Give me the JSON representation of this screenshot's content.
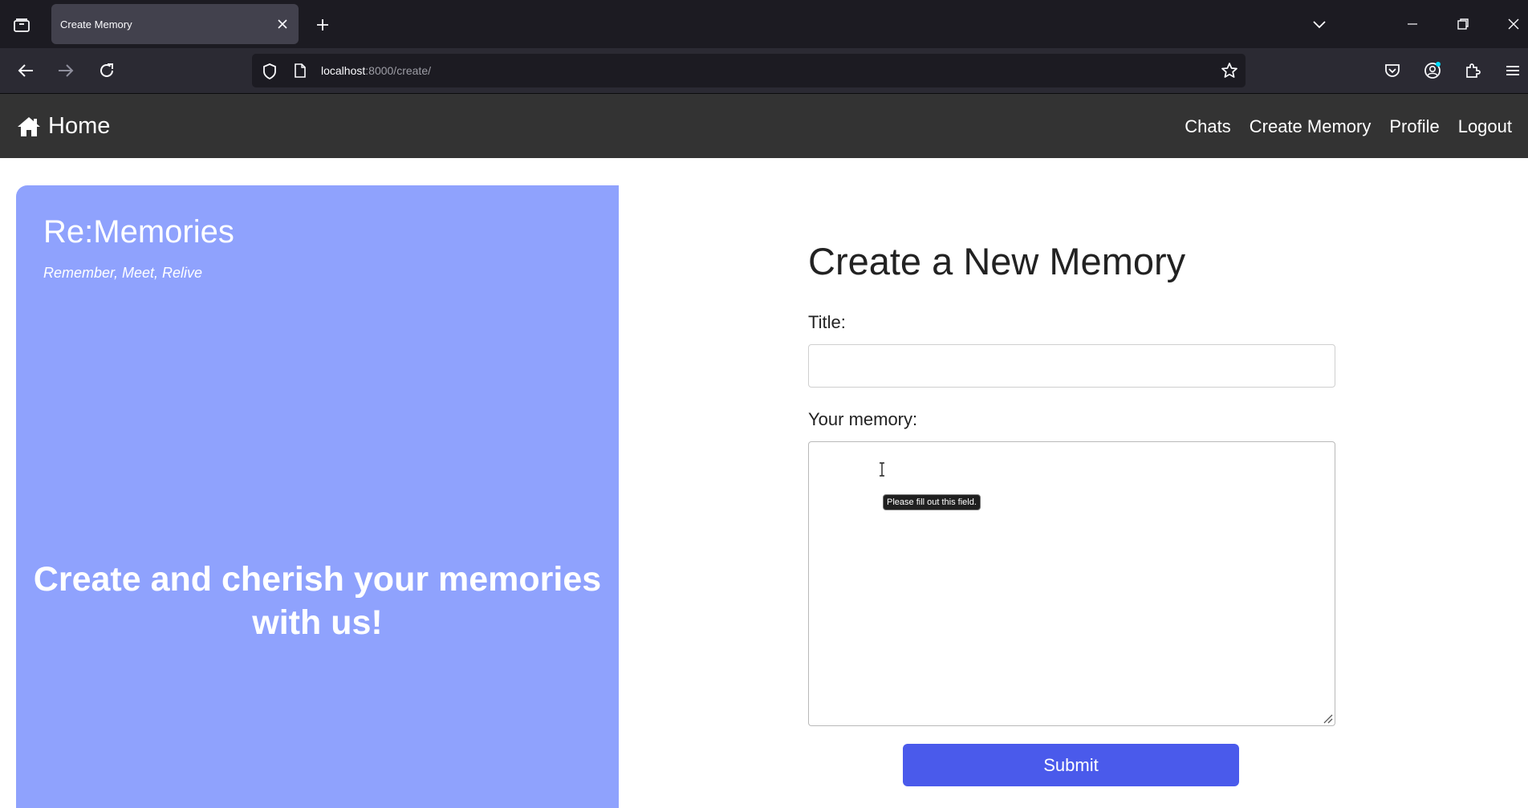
{
  "browser": {
    "tab_title": "Create Memory",
    "url_host": "localhost",
    "url_path": ":8000/create/"
  },
  "site": {
    "brand_label": "Home",
    "nav": [
      "Chats",
      "Create Memory",
      "Profile",
      "Logout"
    ]
  },
  "hero": {
    "title": "Re:Memories",
    "tagline": "Remember, Meet, Relive",
    "message": "Create and cherish your memories with us!"
  },
  "form": {
    "heading": "Create a New Memory",
    "title_label": "Title:",
    "title_value": "",
    "memory_label": "Your memory:",
    "memory_value": "",
    "validation_tooltip": "Please fill out this field.",
    "submit_label": "Submit"
  },
  "colors": {
    "hero_bg": "#8fa2fd",
    "header_bg": "#333333",
    "submit_bg": "#4a5aeb"
  }
}
